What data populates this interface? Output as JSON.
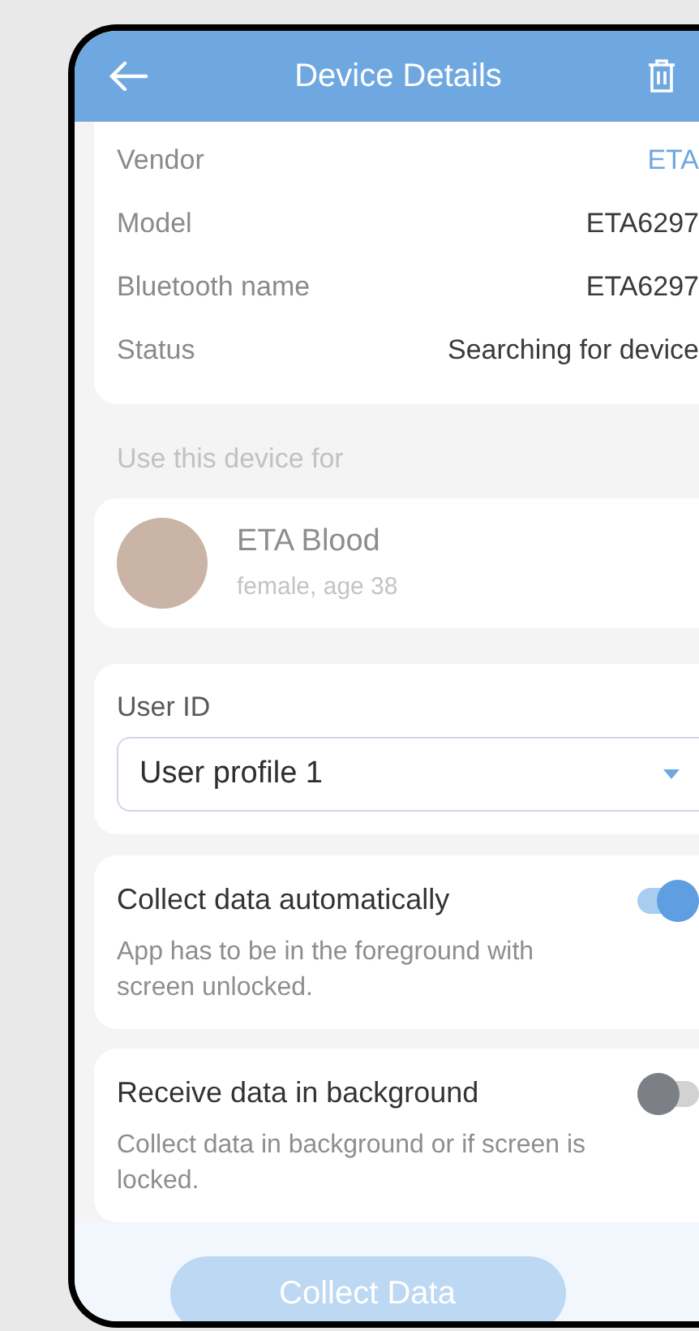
{
  "header": {
    "title": "Device Details"
  },
  "device_info": [
    {
      "label": "Vendor",
      "value": "ETA",
      "kind": "link"
    },
    {
      "label": "Model",
      "value": "ETA6297",
      "kind": "text"
    },
    {
      "label": "Bluetooth name",
      "value": "ETA6297",
      "kind": "text"
    },
    {
      "label": "Status",
      "value": "Searching for device",
      "kind": "text"
    }
  ],
  "section_label": "Use this device for",
  "user": {
    "name": "ETA Blood",
    "details": "female, age 38"
  },
  "user_id": {
    "label": "User ID",
    "value": "User profile 1"
  },
  "settings": [
    {
      "title": "Collect data automatically",
      "description": "App has to be in the foreground with screen unlocked.",
      "on": true
    },
    {
      "title": "Receive data in background",
      "description": "Collect data in background or if screen is locked.",
      "on": false
    }
  ],
  "action_button": {
    "label": "Collect Data",
    "disabled": true
  }
}
